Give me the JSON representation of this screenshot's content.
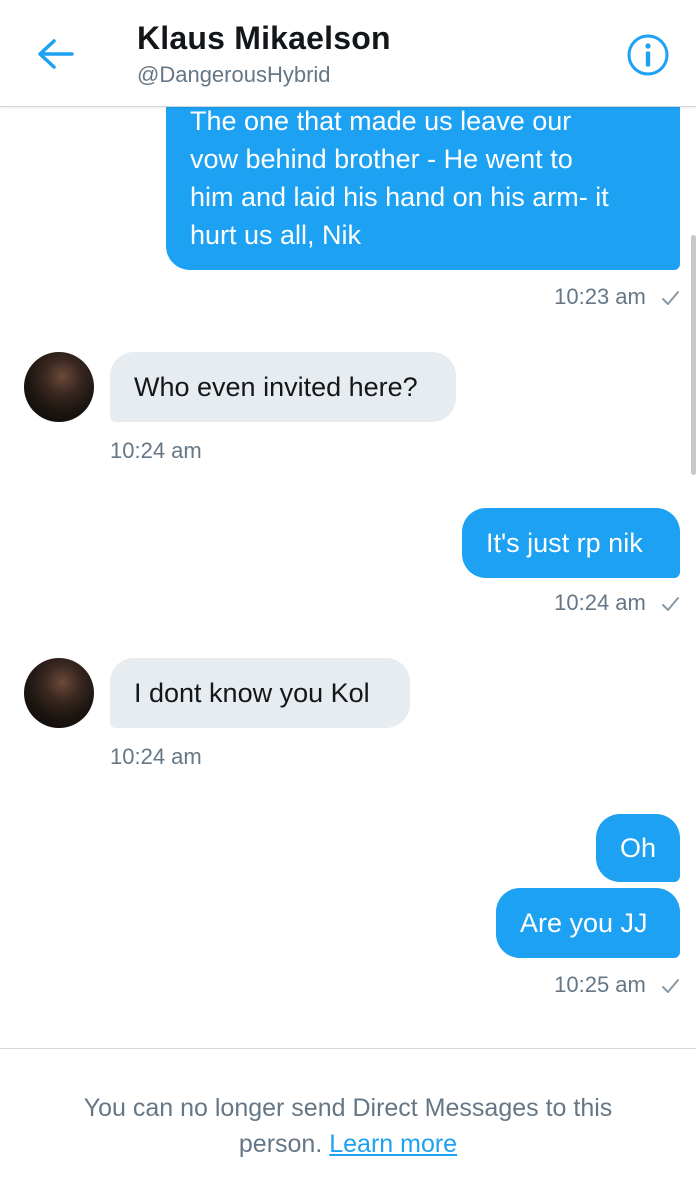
{
  "header": {
    "title": "Klaus Mikaelson",
    "handle": "@DangerousHybrid"
  },
  "messages": [
    {
      "direction": "out",
      "lines": [
        "The one that made us leave our",
        "vow behind brother - He went to",
        "him and laid his hand on his arm- it",
        "hurt us all, Nik"
      ],
      "time": "10:23 am"
    },
    {
      "direction": "in",
      "text": "Who even invited here?",
      "time": "10:24 am"
    },
    {
      "direction": "out",
      "text": "It's just rp nik",
      "time": "10:24 am"
    },
    {
      "direction": "in",
      "text": "I dont know you Kol",
      "time": "10:24 am"
    },
    {
      "direction": "out",
      "text": "Oh"
    },
    {
      "direction": "out",
      "text": "Are you JJ",
      "time": "10:25 am"
    }
  ],
  "footer": {
    "notice": "You can no longer send Direct Messages to this person.",
    "link": "Learn more"
  },
  "colors": {
    "accent": "#1da1f2",
    "incoming_bubble": "#e6ecf0",
    "secondary_text": "#657786"
  },
  "icons": {
    "back": "arrow-left-icon",
    "info": "info-circle-icon",
    "sent": "checkmark-icon"
  }
}
